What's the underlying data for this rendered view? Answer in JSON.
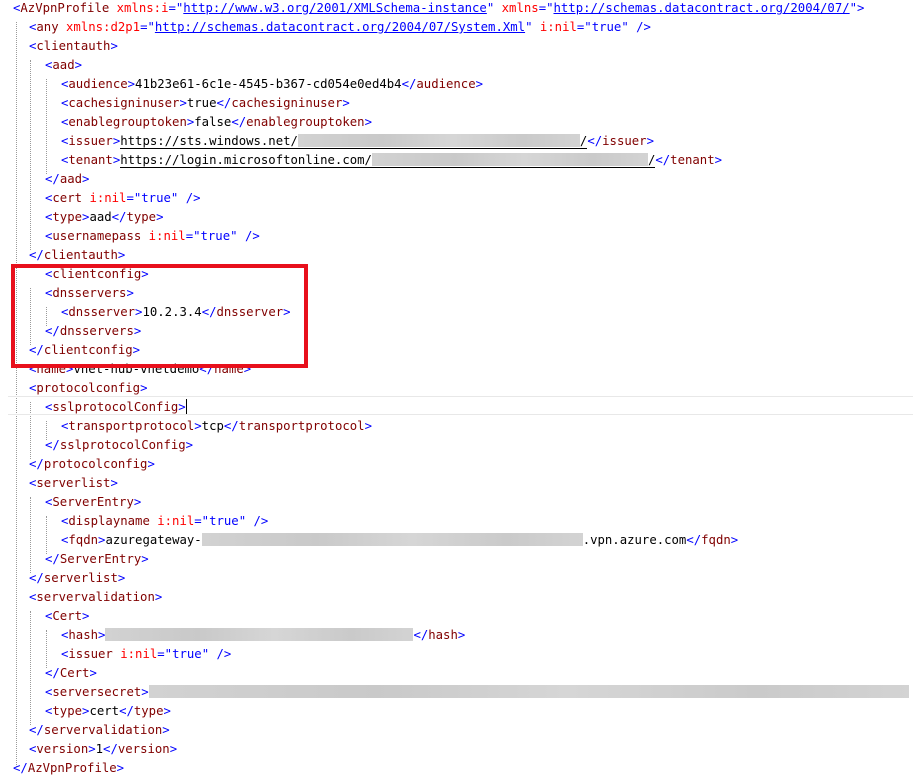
{
  "root": {
    "tag": "AzVpnProfile",
    "xmlns_i_attr": "xmlns:i",
    "xmlns_i_value": "http://www.w3.org/2001/XMLSchema-instance",
    "xmlns_attr": "xmlns",
    "xmlns_value": "http://schemas.datacontract.org/2004/07/"
  },
  "any": {
    "tag": "any",
    "xmlns_attr": "xmlns:d2p1",
    "xmlns_value": "http://schemas.datacontract.org/2004/07/System.Xml",
    "nil_attr": "i:nil",
    "nil_value": "true"
  },
  "clientauth": {
    "tag": "clientauth",
    "aad": {
      "tag": "aad",
      "audience": {
        "tag": "audience",
        "value": "41b23e61-6c1e-4545-b367-cd054e0ed4b4"
      },
      "cachesigninuser": {
        "tag": "cachesigninuser",
        "value": "true"
      },
      "enablegrouptoken": {
        "tag": "enablegrouptoken",
        "value": "false"
      },
      "issuer": {
        "tag": "issuer",
        "value_prefix": "https://sts.windows.net/",
        "value_suffix": "/"
      },
      "tenant": {
        "tag": "tenant",
        "value_prefix": "https://login.microsoftonline.com/",
        "value_suffix": "/"
      }
    },
    "cert": {
      "tag": "cert",
      "nil_attr": "i:nil",
      "nil_value": "true"
    },
    "type": {
      "tag": "type",
      "value": "aad"
    },
    "usernamepass": {
      "tag": "usernamepass",
      "nil_attr": "i:nil",
      "nil_value": "true"
    }
  },
  "clientconfig": {
    "tag": "clientconfig",
    "dnsservers_tag": "dnsservers",
    "dnsserver": {
      "tag": "dnsserver",
      "value": "10.2.3.4"
    }
  },
  "name": {
    "tag": "name",
    "value": "vnet-hub-vnetdemo"
  },
  "protocolconfig": {
    "tag": "protocolconfig",
    "sslprotocolConfig_tag": "sslprotocolConfig",
    "transportprotocol": {
      "tag": "transportprotocol",
      "value": "tcp"
    }
  },
  "serverlist": {
    "tag": "serverlist",
    "serverentry_tag": "ServerEntry",
    "displayname": {
      "tag": "displayname",
      "nil_attr": "i:nil",
      "nil_value": "true"
    },
    "fqdn": {
      "tag": "fqdn",
      "value_prefix": "azuregateway-",
      "value_suffix": ".vpn.azure.com"
    }
  },
  "servervalidation": {
    "tag": "servervalidation",
    "cert_tag": "Cert",
    "hash_tag": "hash",
    "issuer": {
      "tag": "issuer",
      "nil_attr": "i:nil",
      "nil_value": "true"
    },
    "serversecret_tag": "serversecret",
    "type": {
      "tag": "type",
      "value": "cert"
    }
  },
  "version": {
    "tag": "version",
    "value": "1"
  },
  "colors": {
    "tag": "#800000",
    "attribute_name": "#ff0000",
    "attribute_value": "#0000ff",
    "bracket": "#0000ff",
    "highlight_box": "#e8101c",
    "redaction": "#d0d0d0"
  }
}
